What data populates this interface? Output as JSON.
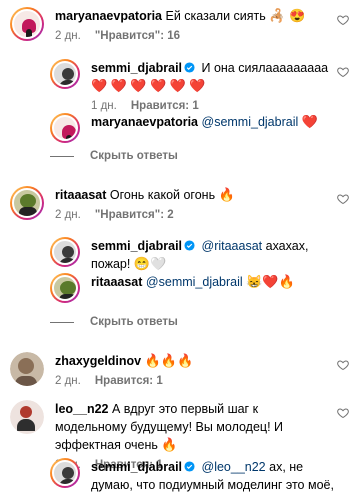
{
  "comments": {
    "c1": {
      "user": "maryanaevpatoria",
      "text": "Ей сказали сиять",
      "emojis": [
        "🦂",
        "😍"
      ],
      "time": "2 дн.",
      "likes": "\"Нравится\": 16"
    },
    "c1r1": {
      "user": "semmi_djabrail",
      "text": "И она сиялааааааааа",
      "emojis": [
        "❤️",
        "❤️",
        "❤️",
        "❤️",
        "❤️",
        "❤️"
      ],
      "time": "1 дн.",
      "likes": "Нравится: 1"
    },
    "c1r2": {
      "user": "maryanaevpatoria",
      "mention": "@semmi_djabrail",
      "emojis": [
        "❤️"
      ]
    },
    "c1_hide": "Скрыть ответы",
    "c2": {
      "user": "ritaaasat",
      "text": "Огонь какой огонь",
      "emojis": [
        "🔥"
      ],
      "time": "2 дн.",
      "likes": "\"Нравится\": 2"
    },
    "c2r1": {
      "user": "semmi_djabrail",
      "mention": "@ritaaasat",
      "text": "ахахах, пожар!",
      "emojis": [
        "😁",
        "🤍"
      ]
    },
    "c2r2": {
      "user": "ritaaasat",
      "mention": "@semmi_djabrail",
      "emojis": [
        "😸",
        "❤️",
        "🔥"
      ]
    },
    "c2_hide": "Скрыть ответы",
    "c3": {
      "user": "zhaxygeldinov",
      "emojis": [
        "🔥",
        "🔥",
        "🔥"
      ],
      "time": "2 дн.",
      "likes": "Нравится: 1"
    },
    "c4": {
      "user": "leo__n22",
      "text": "А вдруг это первый шаг к модельному будущему! Вы молодец! И эффектная очень",
      "emojis": [
        "🔥"
      ],
      "time": "2 дн.",
      "likes": "Нравится: 1"
    },
    "c4r1": {
      "user": "semmi_djabrail",
      "mention": "@leo__n22",
      "text": "ах, не думаю, что подиумный моделинг это моё, но как фотомодель я"
    }
  },
  "colors": {
    "meta": "#737373",
    "mention": "#00376b",
    "verified": "#0095f6"
  },
  "icons": {
    "like": "heart-outline-icon",
    "verified": "verified-badge-icon"
  }
}
